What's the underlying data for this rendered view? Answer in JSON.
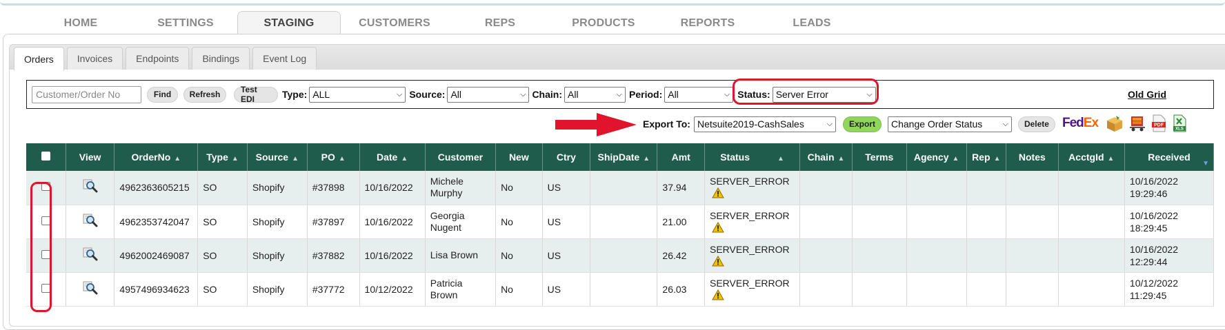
{
  "main_nav": [
    {
      "label": "HOME",
      "active": false
    },
    {
      "label": "SETTINGS",
      "active": false
    },
    {
      "label": "STAGING",
      "active": true
    },
    {
      "label": "CUSTOMERS",
      "active": false
    },
    {
      "label": "REPS",
      "active": false
    },
    {
      "label": "PRODUCTS",
      "active": false
    },
    {
      "label": "REPORTS",
      "active": false
    },
    {
      "label": "LEADS",
      "active": false
    }
  ],
  "sub_tabs": [
    {
      "label": "Orders",
      "active": true
    },
    {
      "label": "Invoices",
      "active": false
    },
    {
      "label": "Endpoints",
      "active": false
    },
    {
      "label": "Bindings",
      "active": false
    },
    {
      "label": "Event Log",
      "active": false
    }
  ],
  "filter": {
    "search_placeholder": "Customer/Order No",
    "find_label": "Find",
    "refresh_label": "Refresh",
    "test_edi_label": "Test EDI",
    "type_label": "Type:",
    "type_value": "ALL",
    "source_label": "Source:",
    "source_value": "All",
    "chain_label": "Chain:",
    "chain_value": "All",
    "period_label": "Period:",
    "period_value": "All",
    "status_label": "Status:",
    "status_value": "Server Error",
    "old_grid_label": "Old Grid"
  },
  "export": {
    "label": "Export To:",
    "target_value": "Netsuite2019-CashSales",
    "export_button": "Export",
    "change_status_value": "Change Order Status",
    "delete_button": "Delete",
    "icons": [
      "fedex-logo",
      "box-icon",
      "cart-icon",
      "pdf-icon",
      "xls-icon"
    ],
    "fedex_text_fe": "Fed",
    "fedex_text_ex": "Ex",
    "pdf_text": "PDF",
    "xls_text": "XLS"
  },
  "grid": {
    "columns": [
      "",
      "View",
      "OrderNo",
      "Type",
      "Source",
      "PO",
      "Date",
      "Customer",
      "New",
      "Ctry",
      "ShipDate",
      "Amt",
      "Status",
      "Chain",
      "Terms",
      "Agency",
      "Rep",
      "Notes",
      "AcctgId",
      "Received"
    ],
    "rows": [
      {
        "order_no": "4962363605215",
        "type": "SO",
        "source": "Shopify",
        "po": "#37898",
        "date": "10/16/2022",
        "customer": "Michele Murphy",
        "new": "No",
        "ctry": "US",
        "ship_date": "",
        "amt": "37.94",
        "status": "SERVER_ERROR",
        "chain": "",
        "terms": "",
        "agency": "",
        "rep": "",
        "notes": "",
        "acctg_id": "",
        "received": "10/16/2022 19:29:46"
      },
      {
        "order_no": "4962353742047",
        "type": "SO",
        "source": "Shopify",
        "po": "#37897",
        "date": "10/16/2022",
        "customer": "Georgia Nugent",
        "new": "No",
        "ctry": "US",
        "ship_date": "",
        "amt": "21.00",
        "status": "SERVER_ERROR",
        "chain": "",
        "terms": "",
        "agency": "",
        "rep": "",
        "notes": "",
        "acctg_id": "",
        "received": "10/16/2022 18:29:45"
      },
      {
        "order_no": "4962002469087",
        "type": "SO",
        "source": "Shopify",
        "po": "#37882",
        "date": "10/16/2022",
        "customer": "Lisa Brown",
        "new": "No",
        "ctry": "US",
        "ship_date": "",
        "amt": "26.42",
        "status": "SERVER_ERROR",
        "chain": "",
        "terms": "",
        "agency": "",
        "rep": "",
        "notes": "",
        "acctg_id": "",
        "received": "10/16/2022 12:29:44"
      },
      {
        "order_no": "4957496934623",
        "type": "SO",
        "source": "Shopify",
        "po": "#37772",
        "date": "10/12/2022",
        "customer": "Patricia Brown",
        "new": "No",
        "ctry": "US",
        "ship_date": "",
        "amt": "26.03",
        "status": "SERVER_ERROR",
        "chain": "",
        "terms": "",
        "agency": "",
        "rep": "",
        "notes": "",
        "acctg_id": "",
        "received": "10/12/2022 11:29:45"
      }
    ]
  },
  "colors": {
    "header_bg": "#1f5c4c",
    "row_alt": "#e6eeee",
    "highlight": "#e0142b",
    "export_green": "#8fd65a",
    "fedex_purple": "#4d148c",
    "fedex_orange": "#ff6200"
  }
}
